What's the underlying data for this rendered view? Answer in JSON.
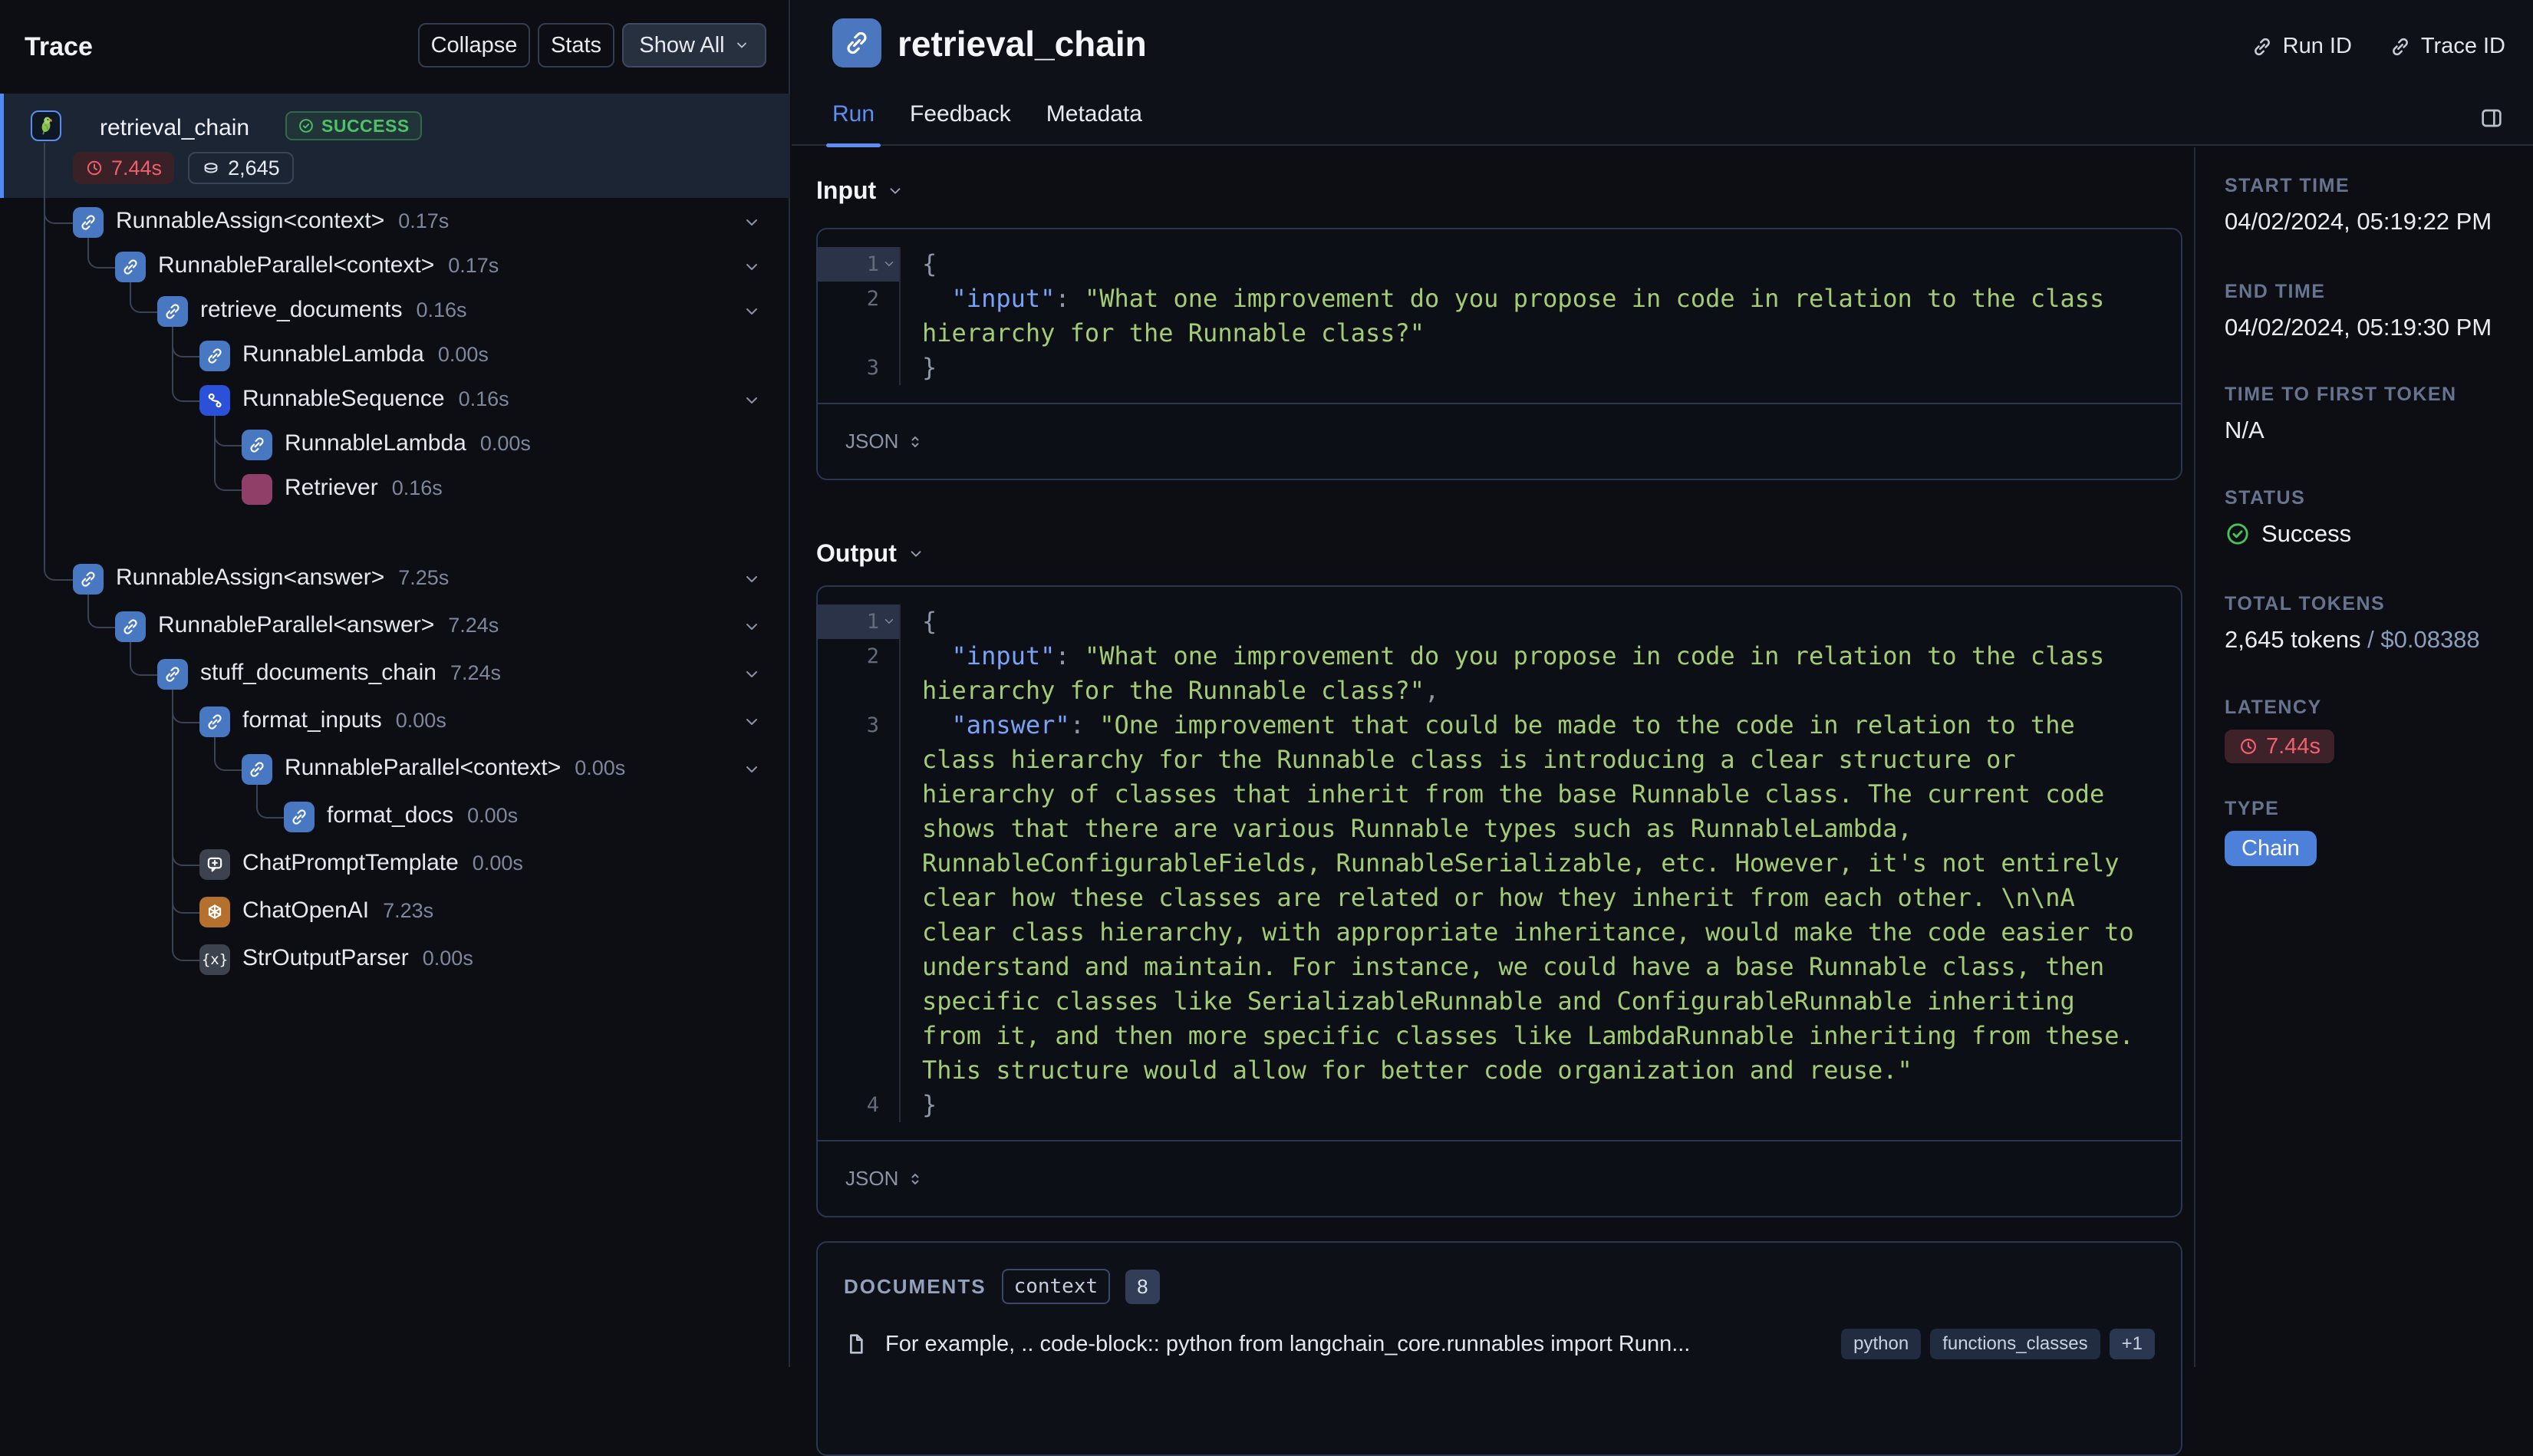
{
  "trace_panel": {
    "title": "Trace",
    "buttons": {
      "collapse": "Collapse",
      "stats": "Stats",
      "show_all": "Show All"
    },
    "root": {
      "name": "retrieval_chain",
      "status": "SUCCESS",
      "latency": "7.44s",
      "tokens": "2,645"
    },
    "nodes": [
      {
        "label": "RunnableAssign<context>",
        "time": "0.17s",
        "icon": "link",
        "level": 1,
        "expandable": true
      },
      {
        "label": "RunnableParallel<context>",
        "time": "0.17s",
        "icon": "link",
        "level": 2,
        "expandable": true
      },
      {
        "label": "retrieve_documents",
        "time": "0.16s",
        "icon": "link",
        "level": 3,
        "expandable": true
      },
      {
        "label": "RunnableLambda",
        "time": "0.00s",
        "icon": "link",
        "level": 4,
        "expandable": false
      },
      {
        "label": "RunnableSequence",
        "time": "0.16s",
        "icon": "sequence",
        "level": 4,
        "expandable": true
      },
      {
        "label": "RunnableLambda",
        "time": "0.00s",
        "icon": "link",
        "level": 5,
        "expandable": false
      },
      {
        "label": "Retriever",
        "time": "0.16s",
        "icon": "retriever",
        "level": 5,
        "expandable": false
      },
      {
        "label": "RunnableAssign<answer>",
        "time": "7.25s",
        "icon": "link",
        "level": 1,
        "expandable": true
      },
      {
        "label": "RunnableParallel<answer>",
        "time": "7.24s",
        "icon": "link",
        "level": 2,
        "expandable": true
      },
      {
        "label": "stuff_documents_chain",
        "time": "7.24s",
        "icon": "link",
        "level": 3,
        "expandable": true
      },
      {
        "label": "format_inputs",
        "time": "0.00s",
        "icon": "link",
        "level": 4,
        "expandable": true
      },
      {
        "label": "RunnableParallel<context>",
        "time": "0.00s",
        "icon": "link",
        "level": 5,
        "expandable": true
      },
      {
        "label": "format_docs",
        "time": "0.00s",
        "icon": "link",
        "level": 6,
        "expandable": false
      },
      {
        "label": "ChatPromptTemplate",
        "time": "0.00s",
        "icon": "prompt",
        "level": 4,
        "expandable": false
      },
      {
        "label": "ChatOpenAI",
        "time": "7.23s",
        "icon": "openai",
        "level": 4,
        "expandable": false
      },
      {
        "label": "StrOutputParser",
        "time": "0.00s",
        "icon": "parser",
        "level": 4,
        "expandable": false
      }
    ]
  },
  "header": {
    "title": "retrieval_chain",
    "run_id_label": "Run ID",
    "trace_id_label": "Trace ID",
    "tabs": [
      "Run",
      "Feedback",
      "Metadata"
    ],
    "active_tab": "Run"
  },
  "input_section": {
    "title": "Input",
    "format_label": "JSON",
    "lines": [
      {
        "num": "1",
        "fold": true,
        "segments": [
          {
            "c": "p",
            "t": "{"
          }
        ]
      },
      {
        "num": "2",
        "segments": [
          {
            "c": "p",
            "t": "  "
          },
          {
            "c": "k",
            "t": "\"input\""
          },
          {
            "c": "p",
            "t": ": "
          },
          {
            "c": "s",
            "t": "\"What one improvement do you propose in code in relation to the class hierarchy for the Runnable class?\""
          }
        ]
      },
      {
        "num": "3",
        "segments": [
          {
            "c": "p",
            "t": "}"
          }
        ]
      }
    ]
  },
  "output_section": {
    "title": "Output",
    "format_label": "JSON",
    "lines": [
      {
        "num": "1",
        "fold": true,
        "segments": [
          {
            "c": "p",
            "t": "{"
          }
        ]
      },
      {
        "num": "2",
        "segments": [
          {
            "c": "p",
            "t": "  "
          },
          {
            "c": "k",
            "t": "\"input\""
          },
          {
            "c": "p",
            "t": ": "
          },
          {
            "c": "s",
            "t": "\"What one improvement do you propose in code in relation to the class hierarchy for the Runnable class?\""
          },
          {
            "c": "p",
            "t": ","
          }
        ]
      },
      {
        "num": "3",
        "segments": [
          {
            "c": "p",
            "t": "  "
          },
          {
            "c": "k",
            "t": "\"answer\""
          },
          {
            "c": "p",
            "t": ": "
          },
          {
            "c": "s",
            "t": "\"One improvement that could be made to the code in relation to the class hierarchy for the Runnable class is introducing a clear structure or hierarchy of classes that inherit from the base Runnable class. The current code shows that there are various Runnable types such as RunnableLambda, RunnableConfigurableFields, RunnableSerializable, etc. However, it's not entirely clear how these classes are related or how they inherit from each other. \\n\\nA clear class hierarchy, with appropriate inheritance, would make the code easier to understand and maintain. For instance, we could have a base Runnable class, then specific classes like SerializableRunnable and ConfigurableRunnable inheriting from it, and then more specific classes like LambdaRunnable inheriting from these. This structure would allow for better code organization and reuse.\""
          }
        ]
      },
      {
        "num": "4",
        "segments": [
          {
            "c": "p",
            "t": "}"
          }
        ]
      }
    ]
  },
  "documents_section": {
    "label": "DOCUMENTS",
    "key_badge": "context",
    "count": "8",
    "doc": {
      "text": "For example, .. code-block:: python from langchain_core.runnables import Runn...",
      "tags": [
        "python",
        "functions_classes"
      ],
      "more": "+1"
    }
  },
  "details_panel": {
    "fields": [
      {
        "label": "START TIME",
        "kind": "text",
        "value": "04/02/2024, 05:19:22 PM"
      },
      {
        "label": "END TIME",
        "kind": "text",
        "value": "04/02/2024, 05:19:30 PM"
      },
      {
        "label": "TIME TO FIRST TOKEN",
        "kind": "text",
        "value": "N/A"
      },
      {
        "label": "STATUS",
        "kind": "status",
        "value": "Success"
      },
      {
        "label": "TOTAL TOKENS",
        "kind": "tokens",
        "value": "2,645 tokens",
        "cost": " / $0.08388"
      },
      {
        "label": "LATENCY",
        "kind": "latency",
        "value": "7.44s"
      },
      {
        "label": "TYPE",
        "kind": "type",
        "value": "Chain"
      }
    ]
  },
  "colors": {
    "accent_blue": "#5f8ef3",
    "success_green": "#4cc366",
    "latency_red": "#ef5f6b",
    "chain_badge_blue": "#4c80d9"
  }
}
